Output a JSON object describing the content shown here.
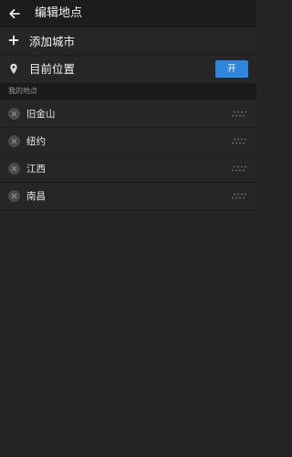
{
  "header": {
    "title": "编辑地点",
    "back_icon": "back-arrow-icon"
  },
  "add_city": {
    "label": "添加城市",
    "icon": "plus-icon"
  },
  "current_location": {
    "label": "目前位置",
    "icon": "location-pin-icon",
    "toggle_label": "开",
    "toggle_color": "#2e86de"
  },
  "my_places": {
    "section_title": "我的地点",
    "cities": [
      {
        "name": "旧金山"
      },
      {
        "name": "纽约"
      },
      {
        "name": "江西"
      },
      {
        "name": "南昌"
      }
    ]
  }
}
